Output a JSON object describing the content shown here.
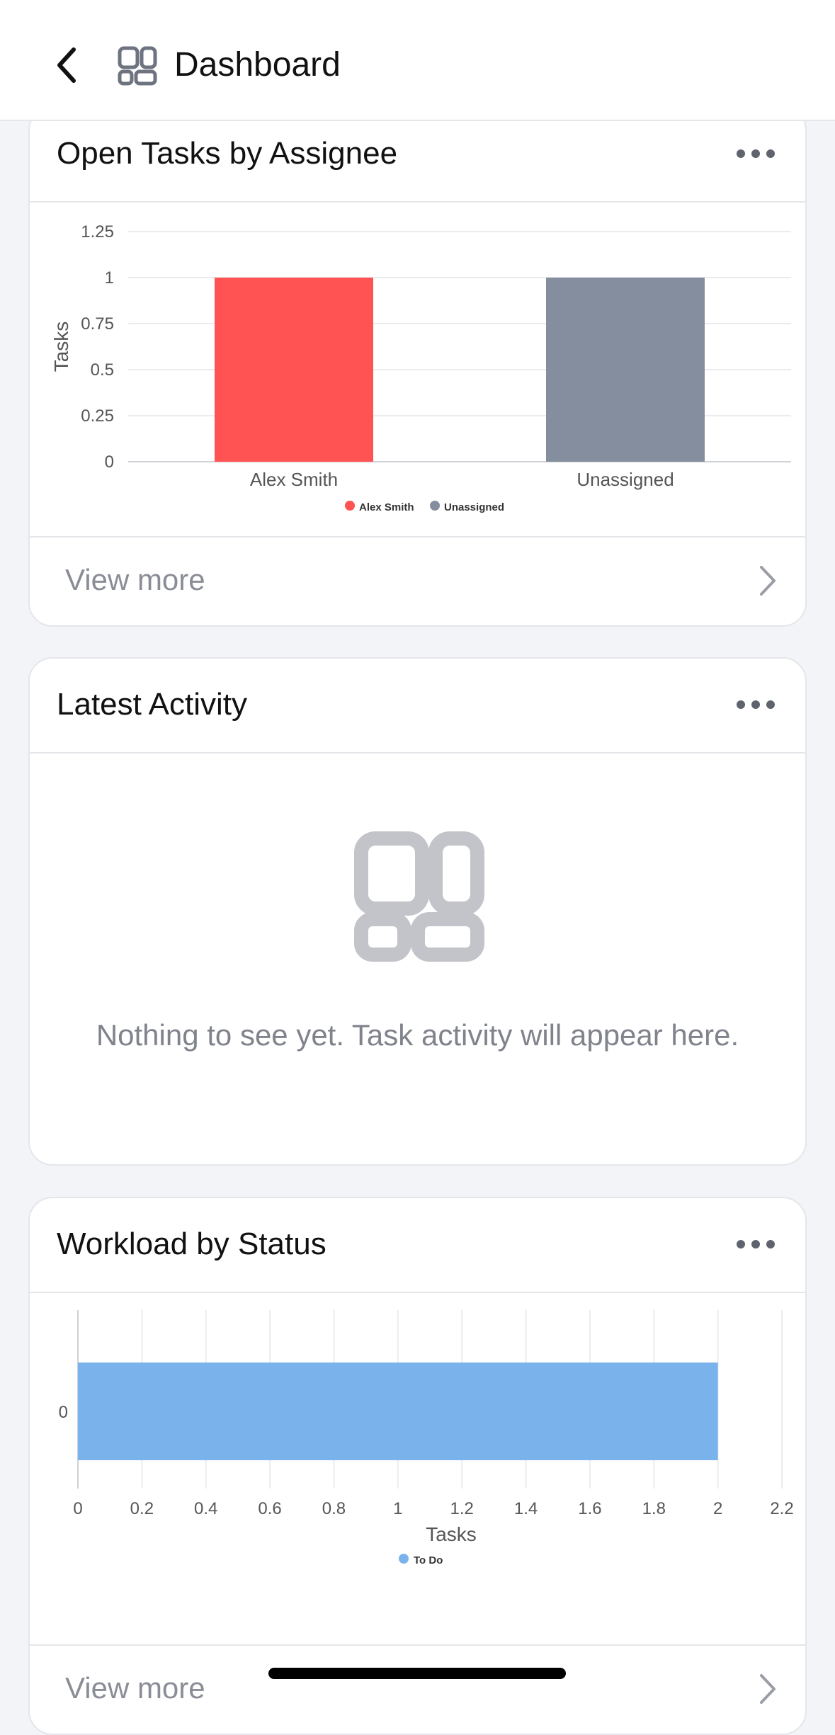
{
  "header": {
    "title": "Dashboard",
    "back_icon": "chevron-left-icon",
    "app_icon": "dashboard-grid-icon"
  },
  "cards": {
    "open_tasks": {
      "title": "Open Tasks by Assignee",
      "footer_label": "View more",
      "menu_icon": "more-horizontal-icon"
    },
    "latest_activity": {
      "title": "Latest Activity",
      "empty_icon": "dashboard-grid-icon",
      "empty_text": "Nothing to see yet.  Task activity will appear here.",
      "menu_icon": "more-horizontal-icon"
    },
    "workload": {
      "title": "Workload by Status",
      "footer_label": "View more",
      "menu_icon": "more-horizontal-icon"
    }
  },
  "colors": {
    "red": "#ff5252",
    "gray": "#858e9e",
    "blue": "#7ab3ec",
    "accent_text": "#8a8d96"
  },
  "chart_data": [
    {
      "type": "bar",
      "title": "Open Tasks by Assignee",
      "categories": [
        "Alex Smith",
        "Unassigned"
      ],
      "values": [
        1,
        1
      ],
      "colors": [
        "#ff5252",
        "#858e9e"
      ],
      "xlabel": "",
      "ylabel": "Tasks",
      "ylim": [
        0,
        1.25
      ],
      "yticks": [
        "0",
        "0.25",
        "0.5",
        "0.75",
        "1",
        "1.25"
      ],
      "legend": [
        "Alex Smith",
        "Unassigned"
      ],
      "legend_position": "bottom",
      "grid": true
    },
    {
      "type": "bar",
      "orientation": "horizontal",
      "title": "Workload by Status",
      "categories": [
        "0"
      ],
      "series": [
        {
          "name": "To Do",
          "values": [
            2
          ]
        }
      ],
      "colors": [
        "#7ab3ec"
      ],
      "xlabel": "Tasks",
      "ylabel": "",
      "xlim": [
        0,
        2.2
      ],
      "xticks": [
        "0",
        "0.2",
        "0.4",
        "0.6",
        "0.8",
        "1",
        "1.2",
        "1.4",
        "1.6",
        "1.8",
        "2",
        "2.2"
      ],
      "legend": [
        "To Do"
      ],
      "legend_position": "bottom",
      "grid": true
    }
  ]
}
